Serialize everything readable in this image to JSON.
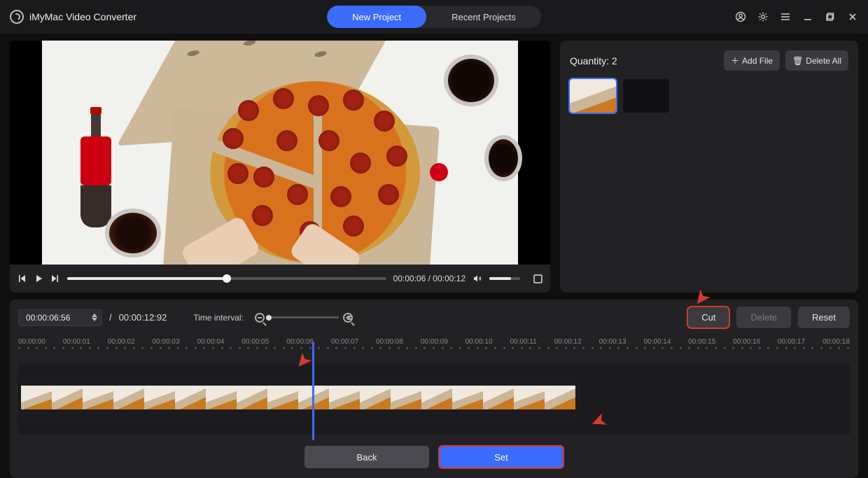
{
  "app": {
    "title": "iMyMac Video Converter"
  },
  "tabs": {
    "new_project": "New Project",
    "recent_projects": "Recent Projects"
  },
  "player": {
    "current": "00:00:06",
    "total": "00:00:12"
  },
  "side": {
    "quantity_label": "Quantity:",
    "quantity_value": "2",
    "add_file": "Add File",
    "delete_all": "Delete All"
  },
  "editor": {
    "pos_value": "00:00:06:56",
    "duration": "00:00:12:92",
    "interval_label": "Time interval:",
    "cut": "Cut",
    "delete": "Delete",
    "reset": "Reset",
    "back": "Back",
    "set": "Set"
  },
  "timeline": {
    "labels": [
      "00:00:00",
      "00:00:01",
      "00:00:02",
      "00:00:03",
      "00:00:04",
      "00:00:05",
      "00:00:06",
      "00:00:07",
      "00:00:08",
      "00:00:09",
      "00:00:10",
      "00:00:11",
      "00:00:12",
      "00:00:13",
      "00:00:14",
      "00:00:15",
      "00:00:16",
      "00:00:17",
      "00:00:18"
    ]
  }
}
